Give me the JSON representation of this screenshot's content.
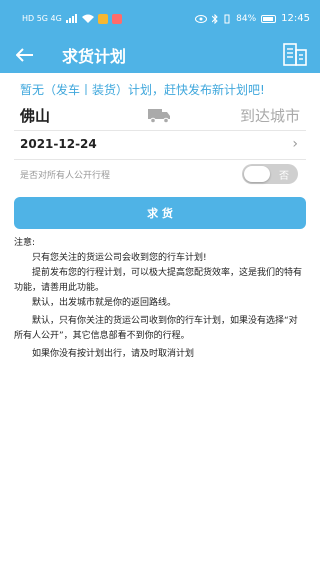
{
  "status_bar": {
    "network_text": "HD 5G 4G",
    "battery_text": "84%",
    "time": "12:45"
  },
  "app_bar": {
    "title": "求货计划"
  },
  "notice": "暂无（发车丨装货）计划，赶快发布新计划吧!",
  "route": {
    "from": "佛山",
    "to_placeholder": "到达城市"
  },
  "date": "2021-12-24",
  "public_toggle": {
    "label": "是否对所有人公开行程",
    "value_text": "否"
  },
  "submit_label": "求 货",
  "notes": {
    "title": "注意:",
    "lines": [
      "只有您关注的货运公司会收到您的行车计划!",
      "提前发布您的行程计划，可以极大提高您配货效率，这是我们的特有功能，请善用此功能。",
      "默认，出发城市就是你的返回路线。",
      "默认，只有你关注的货运公司收到你的行车计划，如果没有选择“对所有人公开”，其它信息部看不到你的行程。",
      "如果你没有按计划出行，请及时取消计划"
    ]
  },
  "colors": {
    "primary": "#4fb3e6",
    "notice_text": "#3fa7dc"
  }
}
